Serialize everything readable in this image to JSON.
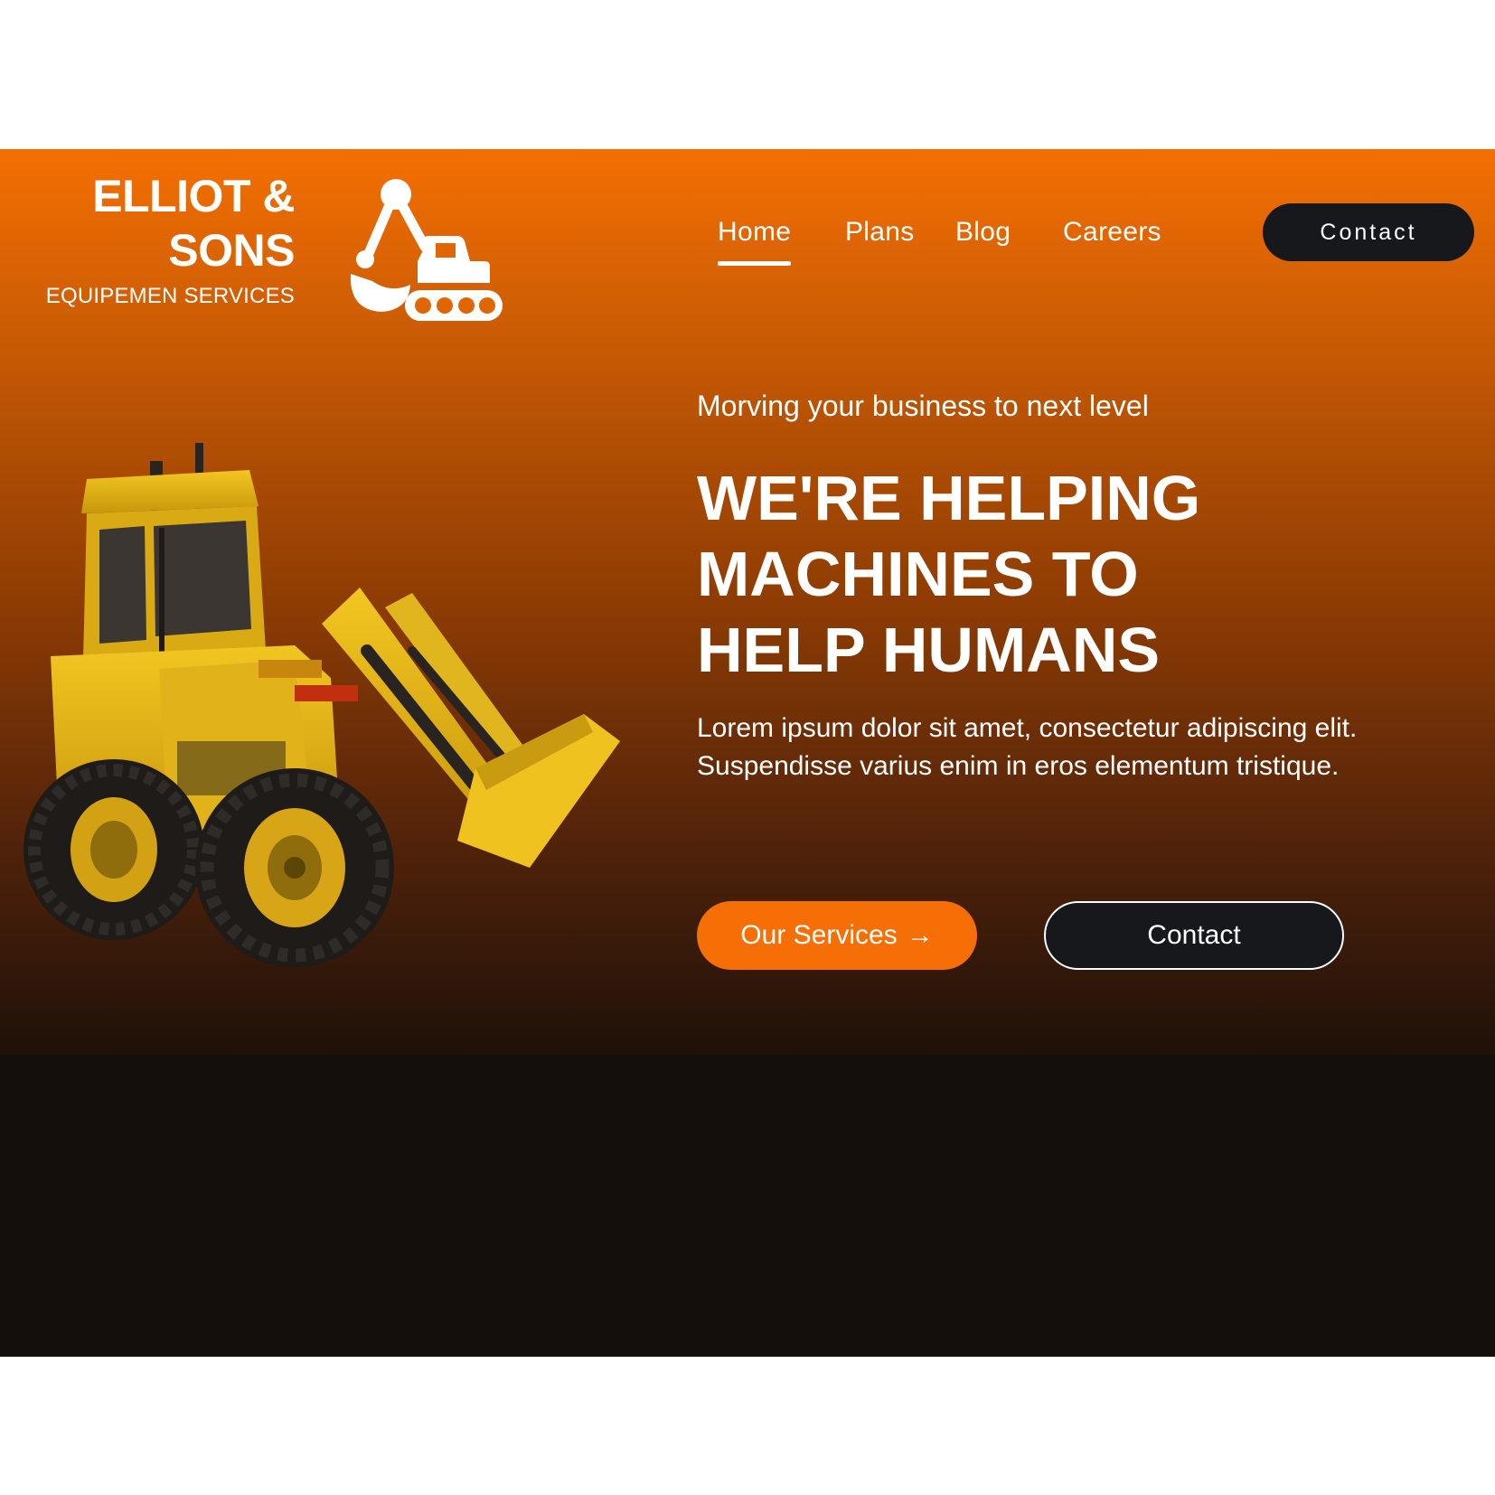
{
  "brand": {
    "name_line1": "ELLIOT &",
    "name_line2": "SONS",
    "subtitle": "EQUIPEMEN SERVICES",
    "logo_icon": "excavator-icon"
  },
  "nav": {
    "items": [
      {
        "label": "Home",
        "active": true
      },
      {
        "label": "Plans",
        "active": false
      },
      {
        "label": "Blog",
        "active": false
      },
      {
        "label": "Careers",
        "active": false
      }
    ],
    "contact_label": "Contact"
  },
  "hero": {
    "eyebrow": "Morving your business to next level",
    "headline": [
      "WE'RE HELPING",
      "MACHINES TO",
      "HELP HUMANS"
    ],
    "body": "Lorem ipsum dolor sit amet, consectetur adipiscing elit. Suspendisse varius enim in eros elementum tristique.",
    "primary_cta": "Our Services",
    "primary_cta_arrow": "→",
    "secondary_cta": "Contact",
    "image_subject": "yellow-wheel-loader"
  },
  "colors": {
    "accent": "#f66e06",
    "gradient_top": "#f46f02",
    "gradient_bottom": "#1e1109",
    "dark_band": "#140f0c",
    "button_dark": "#16181c"
  }
}
